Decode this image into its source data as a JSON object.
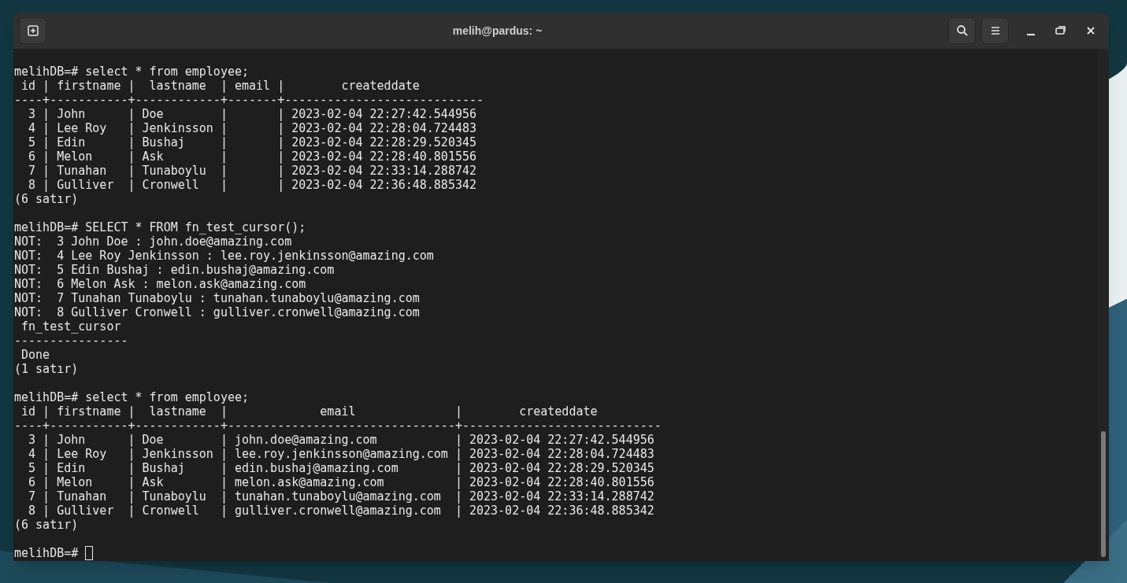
{
  "window": {
    "title": "melih@pardus: ~"
  },
  "terminal": {
    "lines": [
      {
        "kind": "text",
        "text": "melihDB=# select * from employee;"
      },
      {
        "kind": "text",
        "text": " id | firstname |  lastname  | email |        createddate"
      },
      {
        "kind": "text",
        "text": "----+-----------+------------+-------+----------------------------"
      },
      {
        "kind": "text",
        "text": "  3 | John      | Doe        |       | 2023-02-04 22:27:42.544956"
      },
      {
        "kind": "text",
        "text": "  4 | Lee Roy   | Jenkinsson |       | 2023-02-04 22:28:04.724483"
      },
      {
        "kind": "text",
        "text": "  5 | Edin      | Bushaj     |       | 2023-02-04 22:28:29.520345"
      },
      {
        "kind": "text",
        "text": "  6 | Melon     | Ask        |       | 2023-02-04 22:28:40.801556"
      },
      {
        "kind": "text",
        "text": "  7 | Tunahan   | Tunaboylu  |       | 2023-02-04 22:33:14.288742"
      },
      {
        "kind": "text",
        "text": "  8 | Gulliver  | Cronwell   |       | 2023-02-04 22:36:48.885342"
      },
      {
        "kind": "text",
        "text": "(6 satır)"
      },
      {
        "kind": "blank"
      },
      {
        "kind": "text",
        "text": "melihDB=# SELECT * FROM fn_test_cursor();"
      },
      {
        "kind": "text",
        "text": "NOT:  3 John Doe : john.doe@amazing.com"
      },
      {
        "kind": "text",
        "text": "NOT:  4 Lee Roy Jenkinsson : lee.roy.jenkinsson@amazing.com"
      },
      {
        "kind": "text",
        "text": "NOT:  5 Edin Bushaj : edin.bushaj@amazing.com"
      },
      {
        "kind": "text",
        "text": "NOT:  6 Melon Ask : melon.ask@amazing.com"
      },
      {
        "kind": "text",
        "text": "NOT:  7 Tunahan Tunaboylu : tunahan.tunaboylu@amazing.com"
      },
      {
        "kind": "text",
        "text": "NOT:  8 Gulliver Cronwell : gulliver.cronwell@amazing.com"
      },
      {
        "kind": "text",
        "text": " fn_test_cursor"
      },
      {
        "kind": "text",
        "text": "----------------"
      },
      {
        "kind": "text",
        "text": " Done"
      },
      {
        "kind": "text",
        "text": "(1 satır)"
      },
      {
        "kind": "blank"
      },
      {
        "kind": "text",
        "text": "melihDB=# select * from employee;"
      },
      {
        "kind": "text",
        "text": " id | firstname |  lastname  |             email              |        createddate"
      },
      {
        "kind": "text",
        "text": "----+-----------+------------+--------------------------------+----------------------------"
      },
      {
        "kind": "text",
        "text": "  3 | John      | Doe        | john.doe@amazing.com           | 2023-02-04 22:27:42.544956"
      },
      {
        "kind": "text",
        "text": "  4 | Lee Roy   | Jenkinsson | lee.roy.jenkinsson@amazing.com | 2023-02-04 22:28:04.724483"
      },
      {
        "kind": "text",
        "text": "  5 | Edin      | Bushaj     | edin.bushaj@amazing.com        | 2023-02-04 22:28:29.520345"
      },
      {
        "kind": "text",
        "text": "  6 | Melon     | Ask        | melon.ask@amazing.com          | 2023-02-04 22:28:40.801556"
      },
      {
        "kind": "text",
        "text": "  7 | Tunahan   | Tunaboylu  | tunahan.tunaboylu@amazing.com  | 2023-02-04 22:33:14.288742"
      },
      {
        "kind": "text",
        "text": "  8 | Gulliver  | Cronwell   | gulliver.cronwell@amazing.com  | 2023-02-04 22:36:48.885342"
      },
      {
        "kind": "text",
        "text": "(6 satır)"
      },
      {
        "kind": "blank"
      },
      {
        "kind": "prompt",
        "text": "melihDB=#"
      }
    ]
  }
}
